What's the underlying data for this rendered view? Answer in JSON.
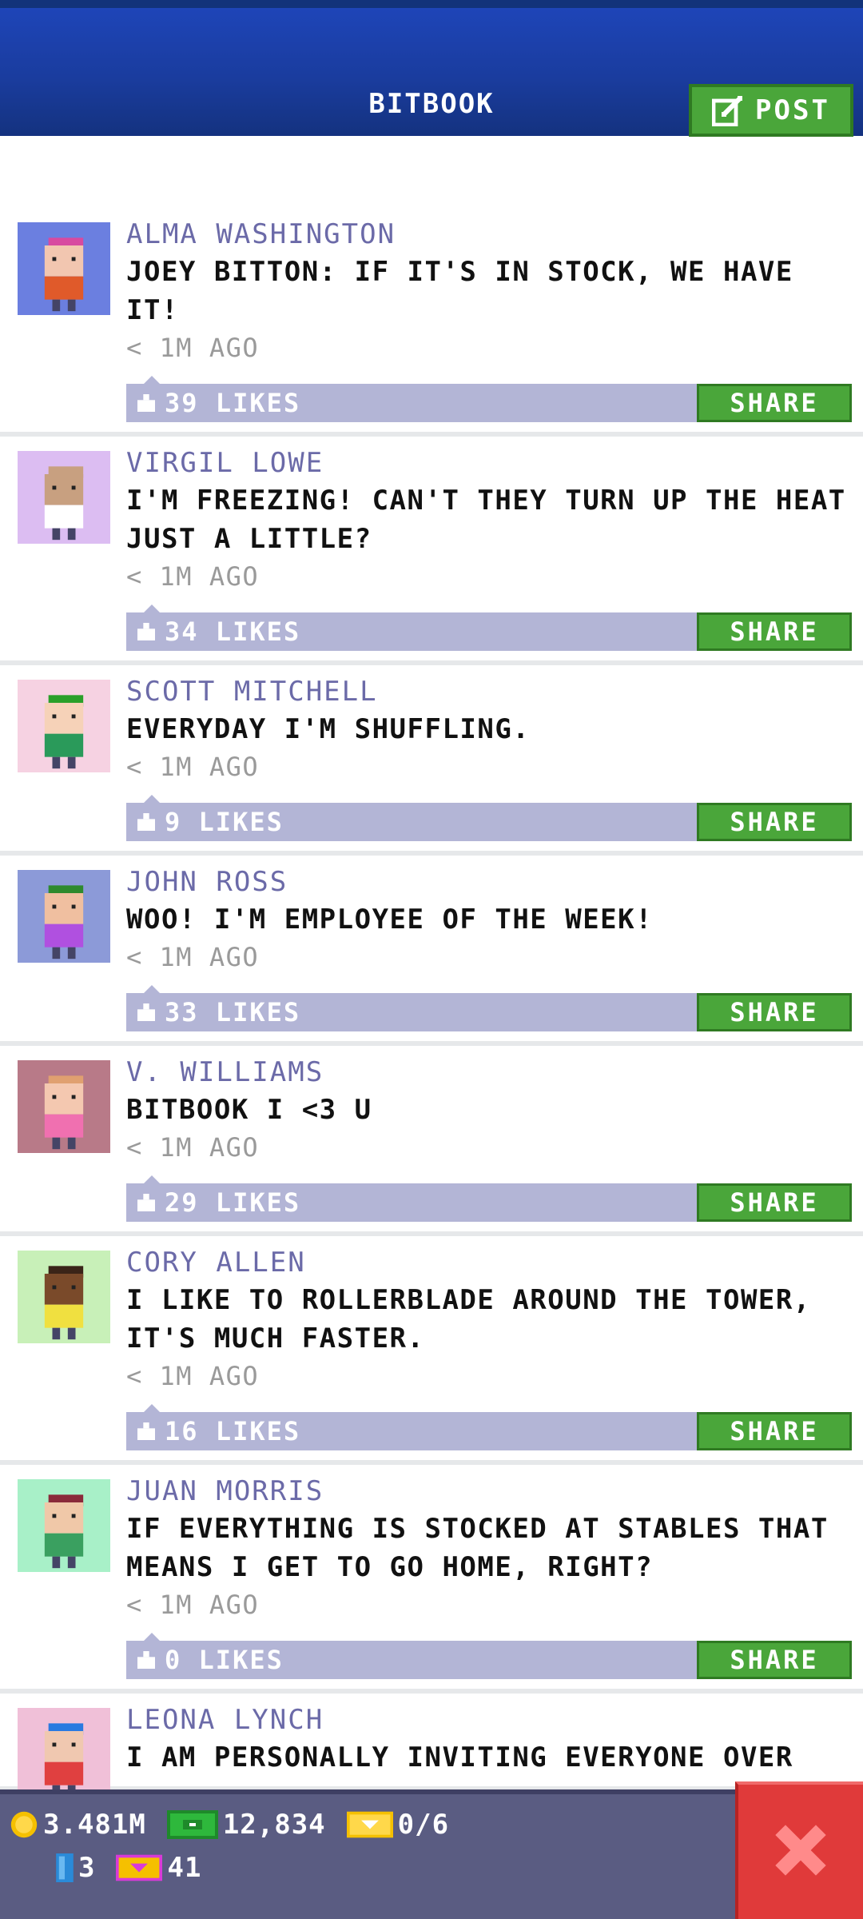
{
  "header": {
    "title": "BITBOOK",
    "post_label": "POST",
    "colors": {
      "bar": "#1a3c9e",
      "post_button": "#4aa63a"
    }
  },
  "feed": {
    "share_label": "SHARE",
    "posts": [
      {
        "author": "ALMA WASHINGTON",
        "message": "JOEY BITTON: IF IT'S IN STOCK, WE HAVE IT!",
        "time": "< 1M AGO",
        "likes": "39 LIKES",
        "avatar_bg": "#6b7fe0",
        "skin": "#f2c6b0",
        "shirt": "#e05a2a",
        "hat": "#d84aa0"
      },
      {
        "author": "VIRGIL LOWE",
        "message": "I'M FREEZING! CAN'T THEY TURN UP THE HEAT JUST A LITTLE?",
        "time": "< 1M AGO",
        "likes": "34 LIKES",
        "avatar_bg": "#dcbdf2",
        "skin": "#c8a080",
        "shirt": "#ffffff",
        "hat": "#c8a080"
      },
      {
        "author": "SCOTT MITCHELL",
        "message": "EVERYDAY I'M SHUFFLING.",
        "time": "< 1M AGO",
        "likes": "9 LIKES",
        "avatar_bg": "#f6d2e2",
        "skin": "#f6d2b8",
        "shirt": "#2a9a5a",
        "hat": "#2aa02a"
      },
      {
        "author": "JOHN ROSS",
        "message": "WOO! I'M EMPLOYEE OF THE WEEK!",
        "time": "< 1M AGO",
        "likes": "33 LIKES",
        "avatar_bg": "#8c9ad8",
        "skin": "#f0bfa0",
        "shirt": "#b050e0",
        "hat": "#2e8a2e"
      },
      {
        "author": "V. WILLIAMS",
        "message": "BITBOOK I <3 U",
        "time": "< 1M AGO",
        "likes": "29 LIKES",
        "avatar_bg": "#b87a88",
        "skin": "#f4c8b0",
        "shirt": "#f070b0",
        "hat": "#e0a070"
      },
      {
        "author": "CORY ALLEN",
        "message": "I LIKE TO ROLLERBLADE AROUND THE TOWER, IT'S MUCH FASTER.",
        "time": "< 1M AGO",
        "likes": "16 LIKES",
        "avatar_bg": "#c8f0b8",
        "skin": "#7a4a2a",
        "shirt": "#f0e040",
        "hat": "#3a2418"
      },
      {
        "author": "JUAN MORRIS",
        "message": "IF EVERYTHING IS STOCKED AT STABLES THAT MEANS I GET TO GO HOME, RIGHT?",
        "time": "< 1M AGO",
        "likes": "0 LIKES",
        "avatar_bg": "#a8f0c8",
        "skin": "#f0c8a8",
        "shirt": "#3aa060",
        "hat": "#8a2a3a"
      },
      {
        "author": "LEONA LYNCH",
        "message": "I AM PERSONALLY INVITING EVERYONE OVER",
        "time": "",
        "likes": "",
        "avatar_bg": "#f0c0d8",
        "skin": "#f0c8b0",
        "shirt": "#e04040",
        "hat": "#2a7ae0"
      }
    ]
  },
  "status_bar": {
    "coins": "3.481M",
    "cash": "12,834",
    "tickets": "0/6",
    "elevators": "3",
    "vip": "41",
    "close_icon": "close-x-icon",
    "colors": {
      "bar": "#5a5c82",
      "close": "#e03a3a"
    }
  }
}
